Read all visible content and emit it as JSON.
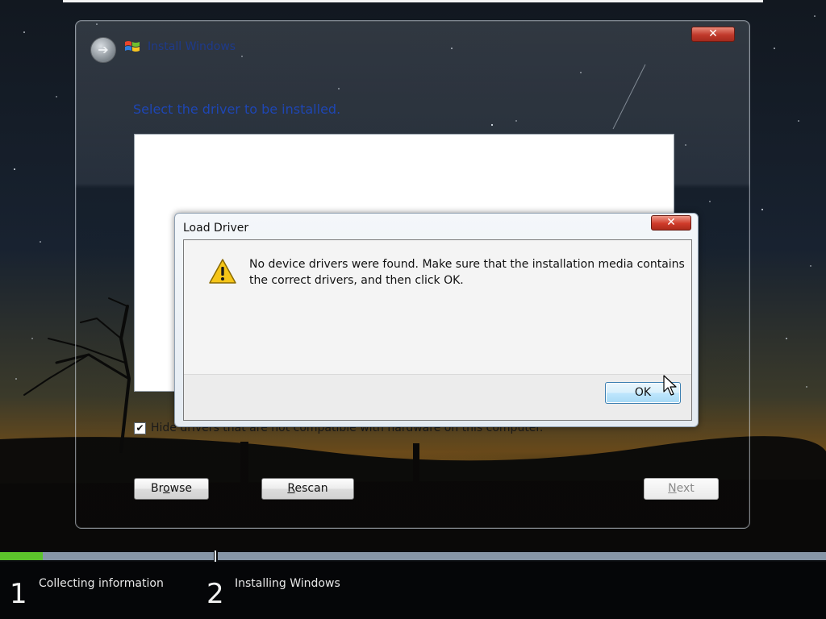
{
  "install_window": {
    "title": "Install Windows",
    "close_label": "✕",
    "heading": "Select the driver to be installed.",
    "hide_checkbox": {
      "checked": true,
      "label": "Hide drivers that are not compatible with hardware on this computer."
    },
    "buttons": {
      "browse": {
        "prefix": "Br",
        "accel": "o",
        "suffix": "wse"
      },
      "rescan": {
        "prefix": "",
        "accel": "R",
        "suffix": "escan"
      },
      "next": {
        "prefix": "",
        "accel": "N",
        "suffix": "ext",
        "enabled": false
      }
    }
  },
  "dialog": {
    "title": "Load Driver",
    "close_label": "✕",
    "message": "No device drivers were found. Make sure that the installation media contains the correct drivers, and then click OK.",
    "icon": "warning-icon",
    "ok_label": "OK"
  },
  "progress": {
    "step1_fraction": 0.2
  },
  "steps": [
    {
      "number": "1",
      "label": "Collecting information"
    },
    {
      "number": "2",
      "label": "Installing Windows"
    }
  ],
  "colors": {
    "heading": "#1e46b4",
    "progress_fill": "#5cc42c",
    "progress_track": "#8696a8",
    "close_red": "#c0392b"
  }
}
